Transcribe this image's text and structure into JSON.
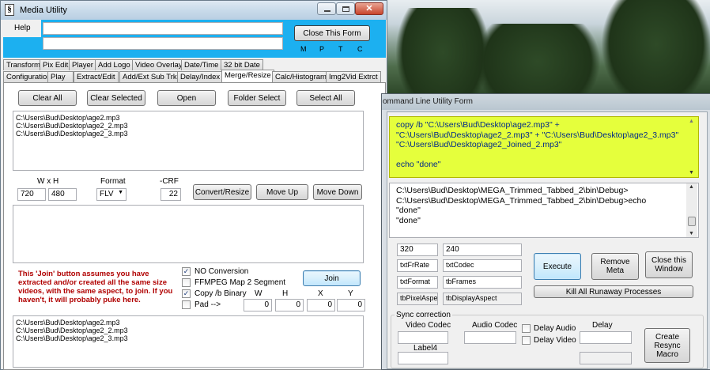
{
  "media_window": {
    "title": "Media Utility",
    "menu_help": "Help",
    "top_input": "",
    "second_input": "",
    "close_button": "Close This Form",
    "mptc": [
      "M",
      "P",
      "T",
      "C"
    ],
    "tabs_row1": [
      "Transform",
      "Pix Edit",
      "Player",
      "Add Logo",
      "Video Overlay",
      "Date/Time",
      "32 bit Date"
    ],
    "tabs_row2": [
      "Configuration",
      "Play",
      "Extract/Edit",
      "Add/Ext Sub Trk",
      "Delay/Index",
      "Merge/Resize",
      "Calc/Histogram",
      "Img2Vid Extrct"
    ],
    "active_tab": "Merge/Resize",
    "buttons": {
      "clear_all": "Clear All",
      "clear_selected": "Clear Selected",
      "open": "Open",
      "folder_select": "Folder Select",
      "select_all": "Select All",
      "convert_resize": "Convert/Resize",
      "move_up": "Move Up",
      "move_down": "Move Down",
      "join": "Join"
    },
    "file_list": [
      "C:\\Users\\Bud\\Desktop\\age2.mp3",
      "C:\\Users\\Bud\\Desktop\\age2_2.mp3",
      "C:\\Users\\Bud\\Desktop\\age2_3.mp3"
    ],
    "labels": {
      "wxh": "W x H",
      "format": "Format",
      "crf": "-CRF",
      "w": "W",
      "h": "H",
      "x": "X",
      "y": "Y"
    },
    "values": {
      "width": "720",
      "height": "480",
      "format": "FLV",
      "crf": "22",
      "pad_w": "0",
      "pad_h": "0",
      "pad_x": "0",
      "pad_y": "0"
    },
    "join_note": "This 'Join' button assumes you have extracted  and/or created all the same size videos, with the same aspect,  to join.  If you haven't, it will probably puke here.",
    "checkboxes": [
      {
        "label": "NO Conversion",
        "checked": true
      },
      {
        "label": "FFMPEG Map 2 Segment",
        "checked": false
      },
      {
        "label": "Copy /b Binary",
        "checked": true
      },
      {
        "label": "Pad  -->",
        "checked": false
      }
    ],
    "bottom_list": [
      "C:\\Users\\Bud\\Desktop\\age2.mp3",
      "C:\\Users\\Bud\\Desktop\\age2_2.mp3",
      "C:\\Users\\Bud\\Desktop\\age2_3.mp3"
    ]
  },
  "cmd_window": {
    "title": "ommand Line Utility Form",
    "command_text": "copy /b \"C:\\Users\\Bud\\Desktop\\age2.mp3\" + \"C:\\Users\\Bud\\Desktop\\age2_2.mp3\" + \"C:\\Users\\Bud\\Desktop\\age2_3.mp3\" \"C:\\Users\\Bud\\Desktop\\age2_Joined_2.mp3\"\n\necho \"done\"",
    "output_text": "C:\\Users\\Bud\\Desktop\\MEGA_Trimmed_Tabbed_2\\bin\\Debug>\nC:\\Users\\Bud\\Desktop\\MEGA_Trimmed_Tabbed_2\\bin\\Debug>echo\n\"done\"\n\"done\"",
    "fields": {
      "w": "320",
      "h": "240",
      "fr_rate": "txtFrRate",
      "codec": "txtCodec",
      "format": "txtFormat",
      "frames": "tbFrames",
      "pixel_aspect": "tbPixelAspec",
      "display_aspect": "tbDisplayAspect"
    },
    "buttons": {
      "execute": "Execute",
      "remove_meta": "Remove Meta",
      "close_window": "Close this Window",
      "kill_all": "Kill All Runaway Processes",
      "create_resync": "Create Resync Macro"
    },
    "sync": {
      "group_label": "Sync correction",
      "video_codec": "Video Codec",
      "audio_codec": "Audio Codec",
      "delay_audio": "Delay Audio",
      "delay_video": "Delay Video",
      "delay": "Delay",
      "label4": "Label4"
    }
  },
  "colors": {
    "accent": "#1cb0f0",
    "command_bg": "#e5ff3c",
    "window_bg": "#f0f0f0"
  }
}
